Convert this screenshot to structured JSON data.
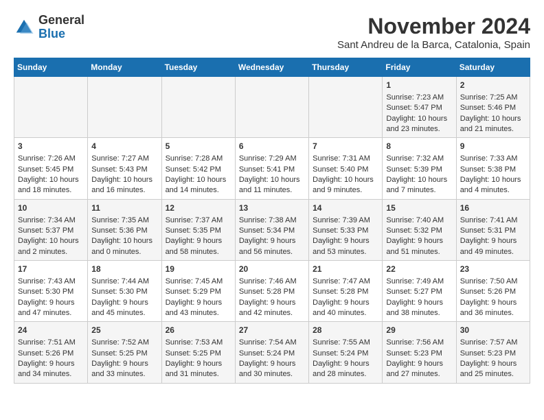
{
  "logo": {
    "general": "General",
    "blue": "Blue"
  },
  "title": "November 2024",
  "subtitle": "Sant Andreu de la Barca, Catalonia, Spain",
  "days_of_week": [
    "Sunday",
    "Monday",
    "Tuesday",
    "Wednesday",
    "Thursday",
    "Friday",
    "Saturday"
  ],
  "weeks": [
    [
      {
        "day": "",
        "content": ""
      },
      {
        "day": "",
        "content": ""
      },
      {
        "day": "",
        "content": ""
      },
      {
        "day": "",
        "content": ""
      },
      {
        "day": "",
        "content": ""
      },
      {
        "day": "1",
        "content": "Sunrise: 7:23 AM\nSunset: 5:47 PM\nDaylight: 10 hours and 23 minutes."
      },
      {
        "day": "2",
        "content": "Sunrise: 7:25 AM\nSunset: 5:46 PM\nDaylight: 10 hours and 21 minutes."
      }
    ],
    [
      {
        "day": "3",
        "content": "Sunrise: 7:26 AM\nSunset: 5:45 PM\nDaylight: 10 hours and 18 minutes."
      },
      {
        "day": "4",
        "content": "Sunrise: 7:27 AM\nSunset: 5:43 PM\nDaylight: 10 hours and 16 minutes."
      },
      {
        "day": "5",
        "content": "Sunrise: 7:28 AM\nSunset: 5:42 PM\nDaylight: 10 hours and 14 minutes."
      },
      {
        "day": "6",
        "content": "Sunrise: 7:29 AM\nSunset: 5:41 PM\nDaylight: 10 hours and 11 minutes."
      },
      {
        "day": "7",
        "content": "Sunrise: 7:31 AM\nSunset: 5:40 PM\nDaylight: 10 hours and 9 minutes."
      },
      {
        "day": "8",
        "content": "Sunrise: 7:32 AM\nSunset: 5:39 PM\nDaylight: 10 hours and 7 minutes."
      },
      {
        "day": "9",
        "content": "Sunrise: 7:33 AM\nSunset: 5:38 PM\nDaylight: 10 hours and 4 minutes."
      }
    ],
    [
      {
        "day": "10",
        "content": "Sunrise: 7:34 AM\nSunset: 5:37 PM\nDaylight: 10 hours and 2 minutes."
      },
      {
        "day": "11",
        "content": "Sunrise: 7:35 AM\nSunset: 5:36 PM\nDaylight: 10 hours and 0 minutes."
      },
      {
        "day": "12",
        "content": "Sunrise: 7:37 AM\nSunset: 5:35 PM\nDaylight: 9 hours and 58 minutes."
      },
      {
        "day": "13",
        "content": "Sunrise: 7:38 AM\nSunset: 5:34 PM\nDaylight: 9 hours and 56 minutes."
      },
      {
        "day": "14",
        "content": "Sunrise: 7:39 AM\nSunset: 5:33 PM\nDaylight: 9 hours and 53 minutes."
      },
      {
        "day": "15",
        "content": "Sunrise: 7:40 AM\nSunset: 5:32 PM\nDaylight: 9 hours and 51 minutes."
      },
      {
        "day": "16",
        "content": "Sunrise: 7:41 AM\nSunset: 5:31 PM\nDaylight: 9 hours and 49 minutes."
      }
    ],
    [
      {
        "day": "17",
        "content": "Sunrise: 7:43 AM\nSunset: 5:30 PM\nDaylight: 9 hours and 47 minutes."
      },
      {
        "day": "18",
        "content": "Sunrise: 7:44 AM\nSunset: 5:30 PM\nDaylight: 9 hours and 45 minutes."
      },
      {
        "day": "19",
        "content": "Sunrise: 7:45 AM\nSunset: 5:29 PM\nDaylight: 9 hours and 43 minutes."
      },
      {
        "day": "20",
        "content": "Sunrise: 7:46 AM\nSunset: 5:28 PM\nDaylight: 9 hours and 42 minutes."
      },
      {
        "day": "21",
        "content": "Sunrise: 7:47 AM\nSunset: 5:28 PM\nDaylight: 9 hours and 40 minutes."
      },
      {
        "day": "22",
        "content": "Sunrise: 7:49 AM\nSunset: 5:27 PM\nDaylight: 9 hours and 38 minutes."
      },
      {
        "day": "23",
        "content": "Sunrise: 7:50 AM\nSunset: 5:26 PM\nDaylight: 9 hours and 36 minutes."
      }
    ],
    [
      {
        "day": "24",
        "content": "Sunrise: 7:51 AM\nSunset: 5:26 PM\nDaylight: 9 hours and 34 minutes."
      },
      {
        "day": "25",
        "content": "Sunrise: 7:52 AM\nSunset: 5:25 PM\nDaylight: 9 hours and 33 minutes."
      },
      {
        "day": "26",
        "content": "Sunrise: 7:53 AM\nSunset: 5:25 PM\nDaylight: 9 hours and 31 minutes."
      },
      {
        "day": "27",
        "content": "Sunrise: 7:54 AM\nSunset: 5:24 PM\nDaylight: 9 hours and 30 minutes."
      },
      {
        "day": "28",
        "content": "Sunrise: 7:55 AM\nSunset: 5:24 PM\nDaylight: 9 hours and 28 minutes."
      },
      {
        "day": "29",
        "content": "Sunrise: 7:56 AM\nSunset: 5:23 PM\nDaylight: 9 hours and 27 minutes."
      },
      {
        "day": "30",
        "content": "Sunrise: 7:57 AM\nSunset: 5:23 PM\nDaylight: 9 hours and 25 minutes."
      }
    ]
  ],
  "colors": {
    "header_bg": "#1a6faf",
    "header_text": "#ffffff",
    "odd_row": "#f5f5f5",
    "even_row": "#ffffff"
  }
}
